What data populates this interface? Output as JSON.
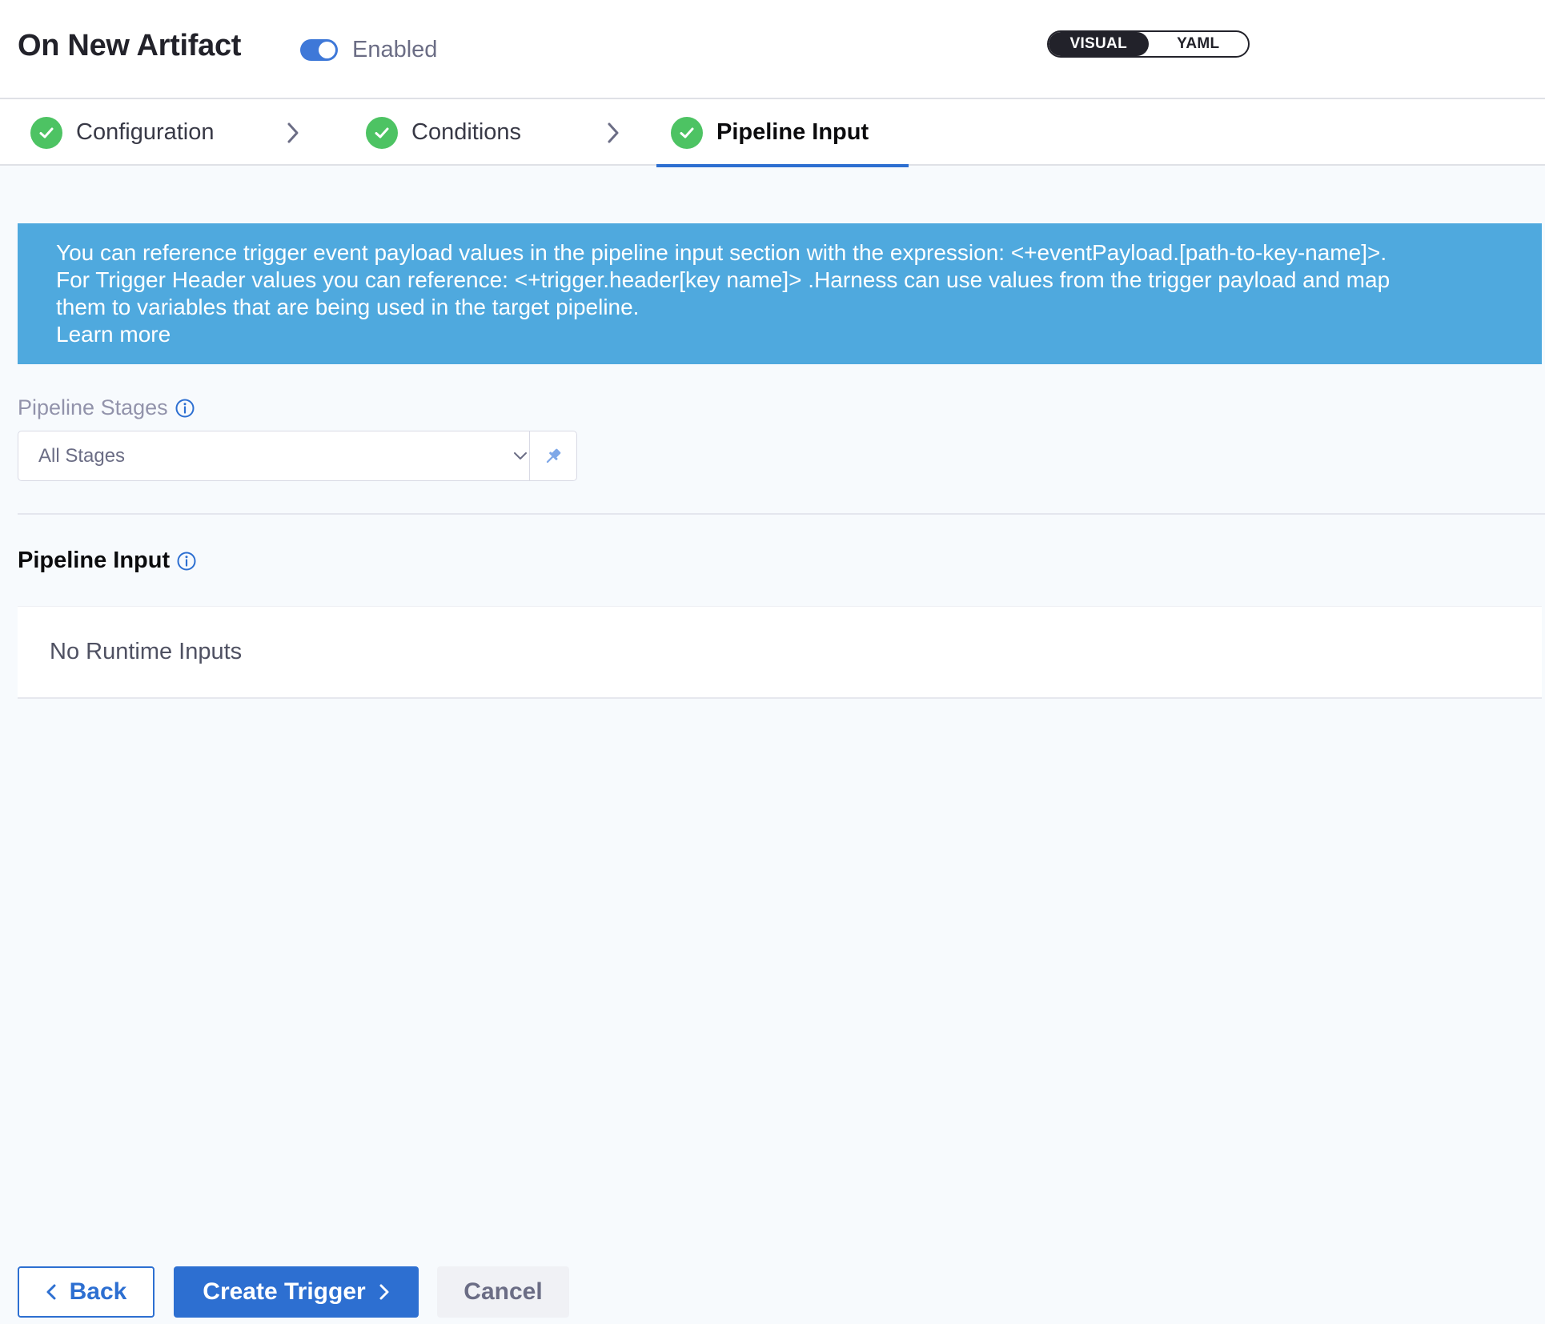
{
  "header": {
    "title": "On New Artifact",
    "enabled_label": "Enabled",
    "enabled": true,
    "view_modes": [
      "VISUAL",
      "YAML"
    ],
    "active_view": "VISUAL"
  },
  "steps": [
    {
      "label": "Configuration",
      "complete": true
    },
    {
      "label": "Conditions",
      "complete": true
    },
    {
      "label": "Pipeline Input",
      "complete": true,
      "active": true
    }
  ],
  "banner": {
    "lines": [
      "You can reference trigger event payload values in the pipeline input section with the expression: <+eventPayload.[path-to-key-name]>.",
      "For Trigger Header values you can reference: <+trigger.header[key name]> .Harness can use values from the trigger payload and map",
      "them to variables that are being used in the target pipeline.",
      "Learn more"
    ]
  },
  "pipeline_stages": {
    "label": "Pipeline Stages",
    "value": "All Stages"
  },
  "pipeline_input": {
    "heading": "Pipeline Input",
    "empty_text": "No Runtime Inputs"
  },
  "footer": {
    "back_label": "Back",
    "create_label": "Create Trigger",
    "cancel_label": "Cancel"
  },
  "colors": {
    "primary": "#2d6fd1",
    "banner": "#4fa9de",
    "success": "#4dc363"
  }
}
